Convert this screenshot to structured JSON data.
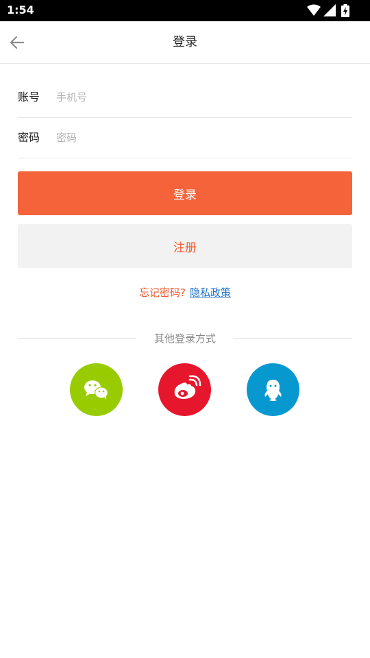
{
  "status_bar": {
    "time": "1:54"
  },
  "header": {
    "title": "登录"
  },
  "form": {
    "account_label": "账号",
    "account_placeholder": "手机号",
    "account_value": "",
    "password_label": "密码",
    "password_placeholder": "密码",
    "password_value": ""
  },
  "buttons": {
    "login_label": "登录",
    "register_label": "注册"
  },
  "links": {
    "forgot_password": "忘记密码?",
    "privacy_policy": "隐私政策"
  },
  "other_login": {
    "title": "其他登录方式",
    "providers": [
      {
        "icon": "wechat-icon",
        "color": "#99cc00"
      },
      {
        "icon": "weibo-icon",
        "color": "#e6162d"
      },
      {
        "icon": "qq-icon",
        "color": "#0898d0"
      }
    ]
  },
  "colors": {
    "primary": "#f5633b",
    "accent_text": "#f0592f",
    "link": "#1e6fc7",
    "wechat": "#99cc00",
    "weibo": "#e6162d",
    "qq": "#0898d0"
  }
}
